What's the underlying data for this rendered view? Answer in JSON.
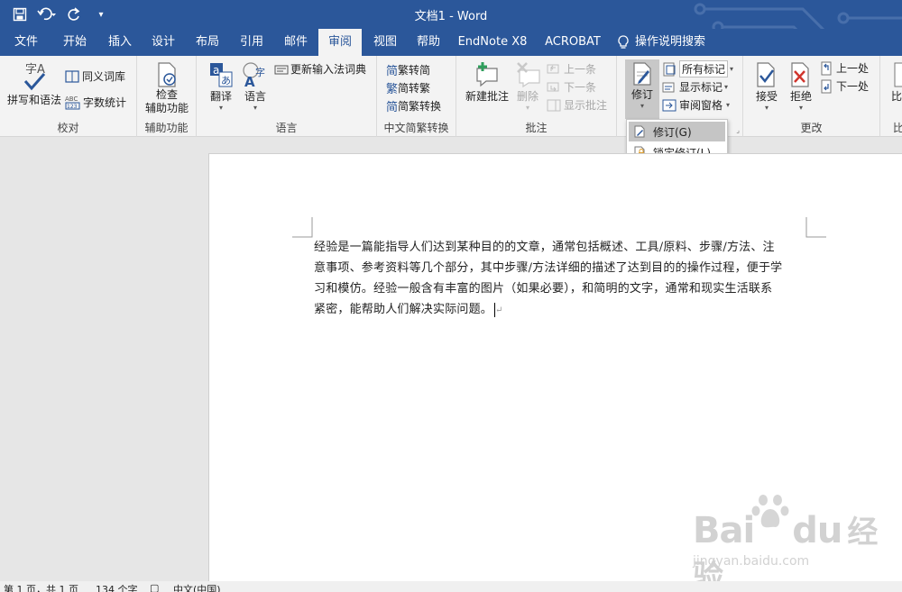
{
  "window": {
    "title": "文档1 - Word"
  },
  "qat": {
    "save": "save-icon",
    "undo": "undo-icon",
    "redo": "redo-icon",
    "customize": "▾"
  },
  "tabs": [
    {
      "label": "文件"
    },
    {
      "label": "开始"
    },
    {
      "label": "插入"
    },
    {
      "label": "设计"
    },
    {
      "label": "布局"
    },
    {
      "label": "引用"
    },
    {
      "label": "邮件"
    },
    {
      "label": "审阅"
    },
    {
      "label": "视图"
    },
    {
      "label": "帮助"
    },
    {
      "label": "EndNote X8"
    },
    {
      "label": "ACROBAT"
    }
  ],
  "tell_me": "操作说明搜索",
  "ribbon": {
    "proofing": {
      "label": "校对",
      "spelling": "拼写和语法",
      "thesaurus": "同义词库",
      "wordcount": "字数统计"
    },
    "accessibility": {
      "label": "辅助功能",
      "check_line1": "检查",
      "check_line2": "辅助功能"
    },
    "language": {
      "label": "语言",
      "translate": "翻译",
      "language": "语言",
      "update_ime": "更新输入法词典"
    },
    "chinese": {
      "label": "中文简繁转换",
      "to_trad": "繁转简",
      "to_simp": "简转繁",
      "convert": "简繁转换",
      "g1": "简",
      "g2": "繁",
      "g3": "简"
    },
    "comments": {
      "label": "批注",
      "new": "新建批注",
      "delete": "删除",
      "prev": "上一条",
      "next": "下一条",
      "show": "显示批注"
    },
    "tracking": {
      "track": "修订",
      "markup": "所有标记",
      "show_markup": "显示标记",
      "pane": "审阅窗格"
    },
    "changes": {
      "label": "更改",
      "accept": "接受",
      "reject": "拒绝",
      "prev": "上一处",
      "next": "下一处"
    },
    "compare": {
      "cut1": "比",
      "cut2": "比"
    }
  },
  "dropdown": {
    "items": [
      {
        "label": "修订(G)"
      },
      {
        "label": "锁定修订(L)"
      }
    ]
  },
  "document": {
    "lines": [
      "经验是一篇能指导人们达到某种目的的文章，通常包括概述、工具/原料、步骤/方法、注",
      "意事项、参考资料等几个部分，其中步骤/方法详细的描述了达到目的的操作过程，便于学",
      "习和模仿。经验一般含有丰富的图片（如果必要），和简明的文字，通常和现实生活联系",
      "紧密，能帮助人们解决实际问题。"
    ],
    "para_mark": "↵"
  },
  "watermark": {
    "brand": "Bai",
    "brand2": "du",
    "brand3": "经验",
    "url": "jingyan.baidu.com"
  },
  "status": {
    "page": "第 1 页，共 1 页",
    "words": "134 个字",
    "lang": "中文(中国)"
  },
  "colors": {
    "accent": "#2b579a",
    "ribbon_bg": "#f3f3f3",
    "page_bg": "#ffffff"
  }
}
